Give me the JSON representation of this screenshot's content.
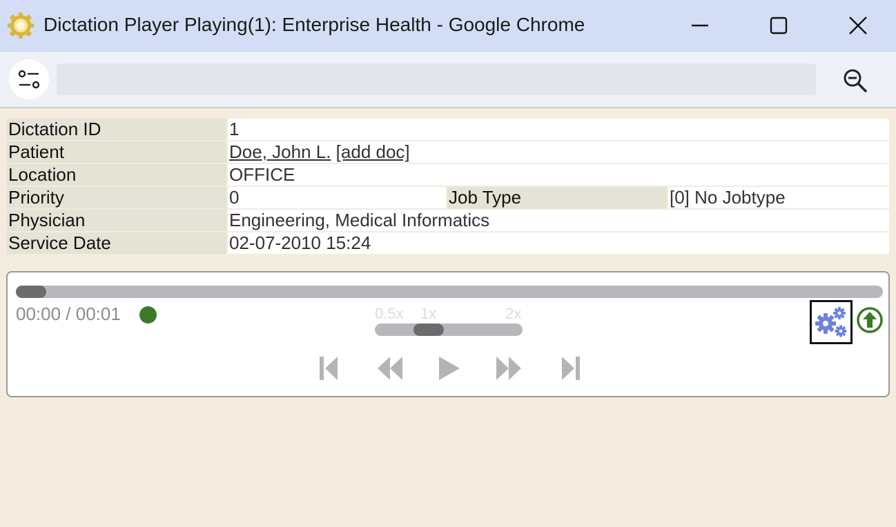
{
  "window": {
    "title": "Dictation Player Playing(1): Enterprise Health - Google Chrome",
    "app_icon": "sun-gear-icon",
    "controls": [
      "minimize-icon",
      "maximize-icon",
      "close-icon"
    ]
  },
  "toolbar": {
    "site_settings_icon": "site-settings-icon",
    "url": "",
    "zoom_icon": "zoom-out-icon"
  },
  "info": {
    "dictation_id_label": "Dictation ID",
    "dictation_id_value": "1",
    "patient_label": "Patient",
    "patient_name": "Doe, John L.",
    "patient_add_doc": "[add doc]",
    "location_label": "Location",
    "location_value": "OFFICE",
    "priority_label": "Priority",
    "priority_value": "0",
    "job_type_label": "Job Type",
    "job_type_value": "[0] No Jobtype",
    "physician_label": "Physician",
    "physician_value": "Engineering, Medical Informatics",
    "service_date_label": "Service Date",
    "service_date_value": "02-07-2010 15:24"
  },
  "player": {
    "time": "00:00 / 00:01",
    "progress_fraction": 0.03,
    "status_color": "#3b7a26",
    "speed_labels": [
      "0.5x",
      "1x",
      "2x"
    ],
    "speed_current": "1x",
    "buttons": [
      "skip-to-start-icon",
      "rewind-icon",
      "play-icon",
      "fast-forward-icon",
      "skip-to-end-icon"
    ],
    "settings_icon": "gears-icon",
    "upload_icon": "upload-arrow-icon",
    "accent_color": "#6c82e0"
  }
}
